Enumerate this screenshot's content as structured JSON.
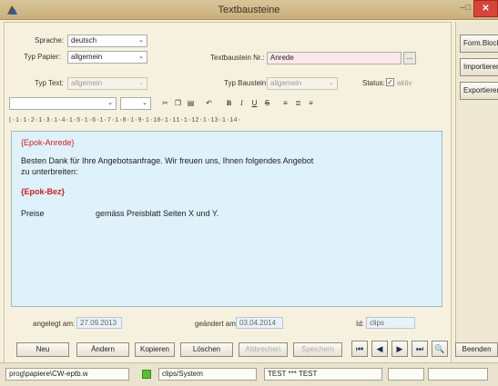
{
  "window": {
    "title": "Textbausteine",
    "controls": {
      "minimize": "–",
      "maximize": "□",
      "close": "✕"
    }
  },
  "form": {
    "sprache_label": "Sprache:",
    "sprache_value": "deutsch",
    "typ_papier_label": "Typ Papier:",
    "typ_papier_value": "allgemein",
    "textbaustein_nr_label": "Textbaustein Nr.:",
    "textbaustein_nr_value": "Anrede",
    "dots_button": "...",
    "typ_text_label": "Typ Text:",
    "typ_text_value": "allgemein",
    "typ_baustein_label": "Typ Baustein:",
    "typ_baustein_value": "allgemein",
    "status_label": "Status:",
    "status_checked": "✓",
    "status_value": "aktiv"
  },
  "side_buttons": [
    "Form.Block",
    "Importieren",
    "Exportieren"
  ],
  "toolbar": {
    "icons": [
      "scissors-icon",
      "copy-icon",
      "paste-icon",
      "undo-icon",
      "bold-icon",
      "italic-icon",
      "underline-icon",
      "strike-icon",
      "align-left-icon",
      "align-center-icon",
      "align-right-icon"
    ],
    "glyphs": [
      "✂",
      "❐",
      "▤",
      "↶",
      "B",
      "I",
      "U",
      "S",
      "≡",
      "≣",
      "≡"
    ]
  },
  "ruler": "⌊·1·1·2·1·3·1·4·1·5·1·6·1·7·1·8·1·9·1·10·1·11·1·12·1·13·1·14·",
  "editor": {
    "line1": "{Epok-Anrede}",
    "line2": "Besten Dank für Ihre Angebotsanfrage. Wir freuen uns, Ihnen folgendes Angebot",
    "line3": "zu unterbreiten:",
    "line4": "{Epok-Bez}",
    "line5_left": "Preise",
    "line5_right": "gemäss Preisblatt Seiten X und Y."
  },
  "meta": {
    "angelegt_label": "angelegt am:",
    "angelegt_value": "27.09.2013",
    "geaendert_label": "geändert am:",
    "geaendert_value": "03.04.2014",
    "id_label": "Id:",
    "id_value": "clips"
  },
  "nav": {
    "neu": "Neu",
    "aendern": "Ändern",
    "kopieren": "Kopieren",
    "loeschen": "Löschen",
    "abbrechen": "Abbrechen",
    "speichern": "Speichern",
    "first": "⏮",
    "prev": "◀",
    "next": "▶",
    "last": "⏭",
    "search": "🔍",
    "beenden": "Beenden"
  },
  "status": {
    "program": "prog\\papiere\\CW-eptb.w",
    "user": "clips/System",
    "env": "TEST *** TEST"
  }
}
